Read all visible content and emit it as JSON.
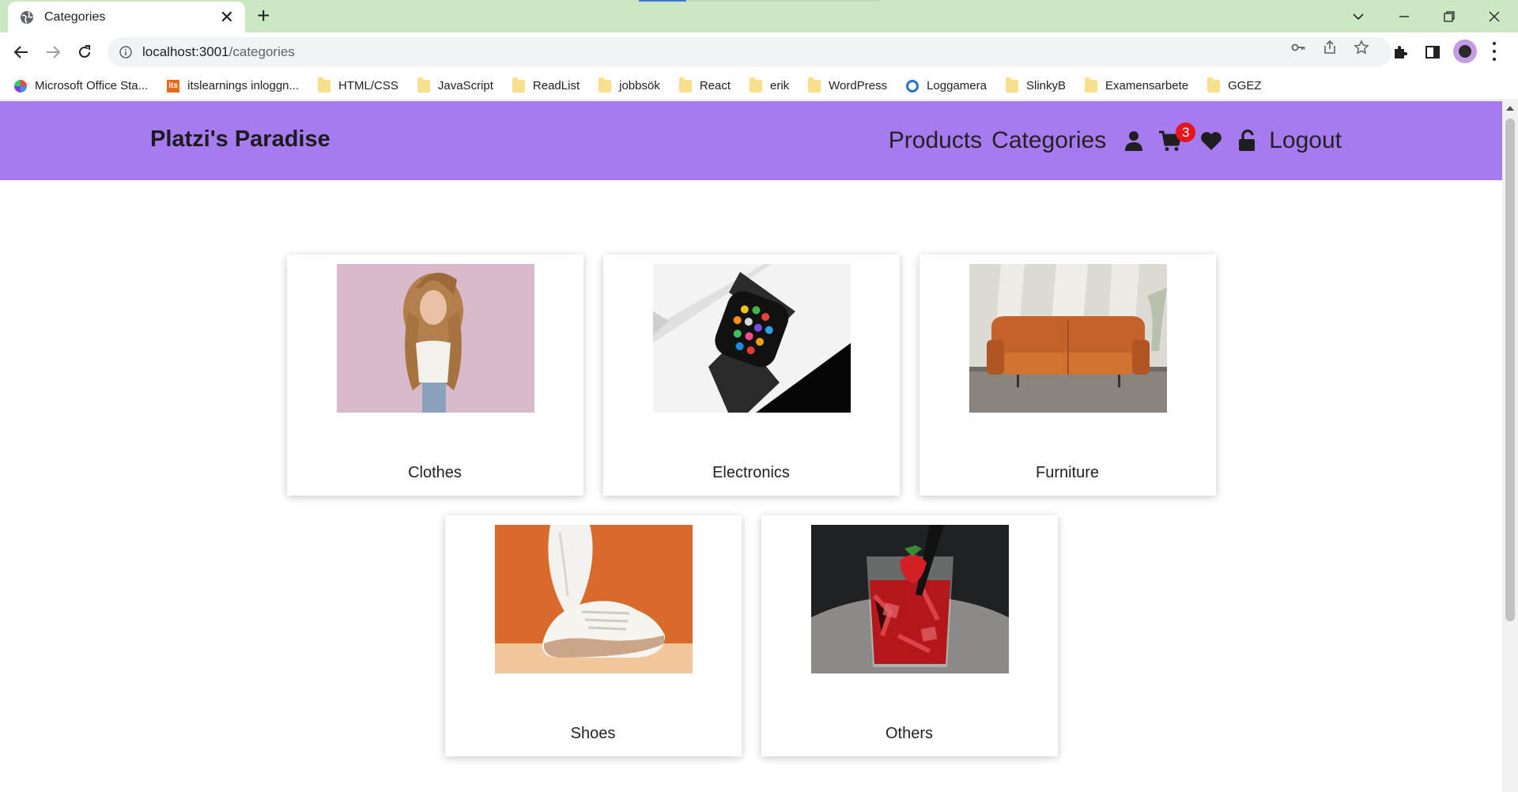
{
  "browser": {
    "tab_title": "Categories",
    "url_host": "localhost:3001",
    "url_path": "/categories",
    "bookmarks": [
      {
        "label": "Microsoft Office Sta...",
        "icon": "office-icon"
      },
      {
        "label": "itslearnings inloggn...",
        "icon": "its-icon"
      },
      {
        "label": "HTML/CSS",
        "icon": "folder-icon"
      },
      {
        "label": "JavaScript",
        "icon": "folder-icon"
      },
      {
        "label": "ReadList",
        "icon": "folder-icon"
      },
      {
        "label": "jobbsök",
        "icon": "folder-icon"
      },
      {
        "label": "React",
        "icon": "folder-icon"
      },
      {
        "label": "erik",
        "icon": "folder-icon"
      },
      {
        "label": "WordPress",
        "icon": "folder-icon"
      },
      {
        "label": "Loggamera",
        "icon": "loggamera-icon"
      },
      {
        "label": "SlinkyB",
        "icon": "folder-icon"
      },
      {
        "label": "Examensarbete",
        "icon": "folder-icon"
      },
      {
        "label": "GGEZ",
        "icon": "folder-icon"
      }
    ],
    "its_logo_text": "its"
  },
  "header": {
    "brand": "Platzi's Paradise",
    "nav_products": "Products",
    "nav_categories": "Categories",
    "cart_count": "3",
    "nav_logout": "Logout",
    "accent_color": "#a87af0"
  },
  "categories": [
    {
      "label": "Clothes",
      "image": "woman-portrait-image"
    },
    {
      "label": "Electronics",
      "image": "smartwatch-image"
    },
    {
      "label": "Furniture",
      "image": "leather-sofa-image"
    },
    {
      "label": "Shoes",
      "image": "sneaker-image"
    },
    {
      "label": "Others",
      "image": "cocktail-drink-image"
    }
  ]
}
